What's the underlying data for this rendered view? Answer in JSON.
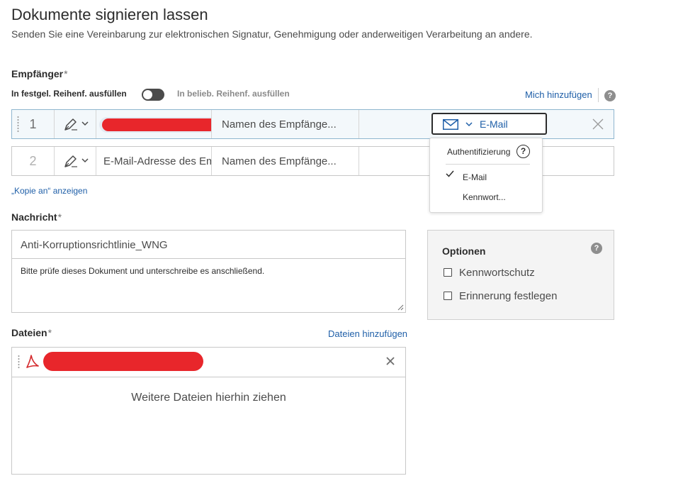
{
  "page": {
    "title": "Dokumente signieren lassen",
    "subtitle": "Senden Sie eine Vereinbarung zur elektronischen Signatur, Genehmigung oder anderweitigen Verarbeitung an andere."
  },
  "recipients": {
    "label": "Empfänger",
    "required_mark": "*",
    "order_fixed_label": "In festgel. Reihenf. ausfüllen",
    "order_any_label": "In belieb. Reihenf. ausfüllen",
    "add_me_link": "Mich hinzufügen",
    "help": "?",
    "cc_link": "„Kopie an“ anzeigen",
    "rows": [
      {
        "number": "1",
        "email": "",
        "name_placeholder": "Namen des Empfänge...",
        "auth": "E-Mail"
      },
      {
        "number": "2",
        "email_placeholder": "E-Mail-Adresse des Empfängers",
        "name_placeholder": "Namen des Empfänge..."
      }
    ]
  },
  "auth_dropdown": {
    "header": "Authentifizierung",
    "help": "?",
    "options": [
      "E-Mail",
      "Kennwort..."
    ],
    "selected": "E-Mail"
  },
  "message": {
    "label": "Nachricht",
    "required_mark": "*",
    "subject": "Anti-Korruptionsrichtlinie_WNG",
    "body": "Bitte prüfe dieses Dokument und unterschreibe es anschließend."
  },
  "options": {
    "title": "Optionen",
    "help": "?",
    "items": [
      {
        "label": "Kennwortschutz",
        "checked": false
      },
      {
        "label": "Erinnerung festlegen",
        "checked": false
      }
    ]
  },
  "files": {
    "label": "Dateien",
    "required_mark": "*",
    "add_link": "Dateien hinzufügen",
    "drop_text": "Weitere Dateien hierhin ziehen",
    "remove": "×"
  },
  "colors": {
    "link": "#1f5fa8",
    "redaction": "#e8262b",
    "pdf": "#d4282b"
  }
}
